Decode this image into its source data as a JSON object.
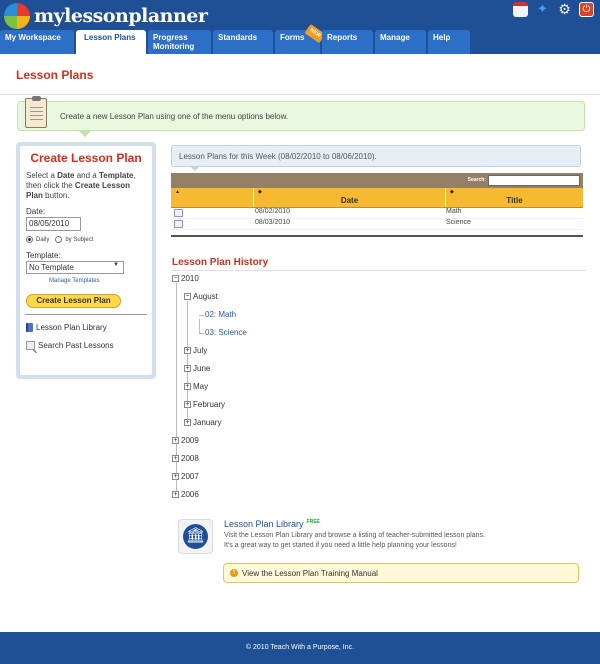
{
  "app": {
    "logo_text": "mylessonplanner"
  },
  "header_icons": [
    "calendar-icon",
    "help-icon",
    "gear-icon",
    "power-icon"
  ],
  "nav": {
    "tabs": [
      {
        "label": "My Workspace",
        "active": false
      },
      {
        "label": "Lesson Plans",
        "active": true
      },
      {
        "label": "Progress Monitoring",
        "active": false
      },
      {
        "label": "Standards",
        "active": false
      },
      {
        "label": "Forms",
        "active": false,
        "badge": "NEW"
      },
      {
        "label": "Reports",
        "active": false
      },
      {
        "label": "Manage",
        "active": false
      },
      {
        "label": "Help",
        "active": false
      }
    ]
  },
  "page": {
    "title": "Lesson Plans",
    "banner_text": "Create a new Lesson Plan using one of the menu options below."
  },
  "create_panel": {
    "title": "Create Lesson Plan",
    "instructions_pre": "Select a ",
    "instructions_date": "Date",
    "instructions_mid": " and a ",
    "instructions_template": "Template",
    "instructions_mid2": ", then click the ",
    "instructions_create": "Create Lesson Plan",
    "instructions_post": " button.",
    "date_label": "Date:",
    "date_value": "08/05/2010",
    "radio_daily": "Daily",
    "radio_subject": "by Subject",
    "template_label": "Template:",
    "template_value": "No Template",
    "manage_templates": "Manage Templates",
    "create_button": "Create Lesson Plan",
    "library_link": "Lesson Plan Library",
    "search_link": "Search Past Lessons"
  },
  "week": {
    "heading": "Lesson Plans for this Week (08/02/2010 to 08/06/2010).",
    "search_label": "Search:",
    "columns": [
      "",
      "Date",
      "Title"
    ],
    "rows": [
      {
        "date": "08/02/2010",
        "title": "Math"
      },
      {
        "date": "08/03/2010",
        "title": "Science"
      }
    ]
  },
  "history": {
    "title": "Lesson Plan History",
    "year_2010": "2010",
    "month_august": "August",
    "lesson_math": "02: Math",
    "lesson_science": "03: Science",
    "month_july": "July",
    "month_june": "June",
    "month_may": "May",
    "month_february": "February",
    "month_january": "January",
    "year_2009": "2009",
    "year_2008": "2008",
    "year_2007": "2007",
    "year_2006": "2006"
  },
  "library": {
    "title": "Lesson Plan Library",
    "badge": "FREE",
    "desc1": "Visit the Lesson Plan Library and browse a listing of teacher-submitted lesson plans.",
    "desc2": "It's a great way to get started if you need a little help planning your lessons!",
    "manual_link": "View the Lesson Plan Training Manual"
  },
  "footer": {
    "text": "© 2010 Teach With a Purpose, Inc."
  }
}
